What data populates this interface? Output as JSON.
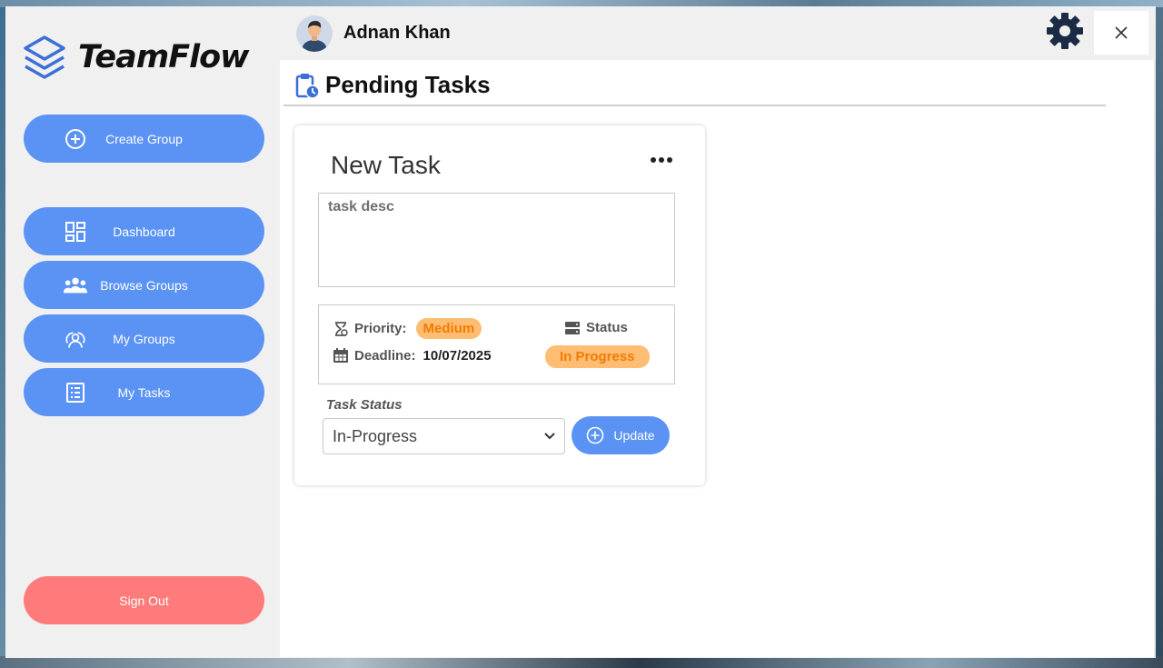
{
  "app": {
    "name": "TeamFlow"
  },
  "user": {
    "name": "Adnan Khan"
  },
  "sidebar": {
    "items": [
      {
        "label": "Create Group",
        "icon": "plus-circle-icon"
      },
      {
        "label": "Dashboard",
        "icon": "dashboard-icon"
      },
      {
        "label": "Browse Groups",
        "icon": "users-icon"
      },
      {
        "label": "My Groups",
        "icon": "group-icon"
      },
      {
        "label": "My Tasks",
        "icon": "list-icon"
      }
    ],
    "signout_label": "Sign Out"
  },
  "page": {
    "title": "Pending Tasks"
  },
  "task": {
    "title": "New Task",
    "description": "task desc",
    "priority_label": "Priority:",
    "priority_value": "Medium",
    "deadline_label": "Deadline:",
    "deadline_value": "10/07/2025",
    "status_label": "Status",
    "status_value": "In Progress",
    "task_status_label": "Task Status",
    "task_status_selected": "In-Progress",
    "update_label": "Update"
  },
  "colors": {
    "primary": "#5b93f5",
    "signout": "#ff7b7b",
    "pill_bg": "#ffbd74",
    "pill_text": "#ef7c00"
  }
}
